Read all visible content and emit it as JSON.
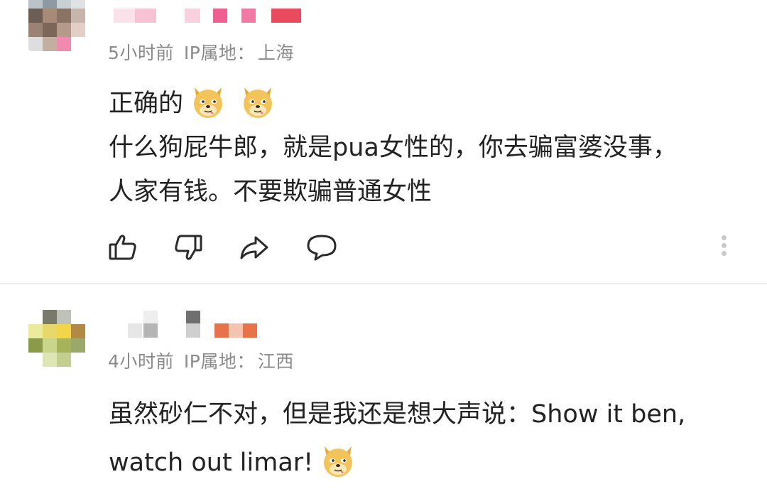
{
  "comments": [
    {
      "time": "5小时前",
      "ip_label": "IP属地：",
      "ip_location": "上海",
      "lines": [
        "正确的",
        "什么狗屁牛郎，就是pua女性的，你去骗富婆没事，",
        "人家有钱。不要欺骗普通女性"
      ],
      "emoji": [
        "doge-emoji",
        "doge-emoji"
      ],
      "actions": [
        "thumbs-up-icon",
        "thumbs-down-icon",
        "share-icon",
        "comment-icon",
        "more-icon"
      ]
    },
    {
      "time": "4小时前",
      "ip_label": "IP属地：",
      "ip_location": "江西",
      "lines": [
        "虽然砂仁不对，但是我还是想大声说：Show it ben,",
        "watch out limar!"
      ],
      "emoji": [
        "doge-emoji"
      ]
    }
  ],
  "colors": {
    "text": "#222222",
    "meta": "#8a8a8a",
    "icon": "#2b2b2b",
    "divider": "#eeeeee",
    "username_pixels_1": "#f06a9c",
    "username_pixels_2": "#e8734a"
  }
}
